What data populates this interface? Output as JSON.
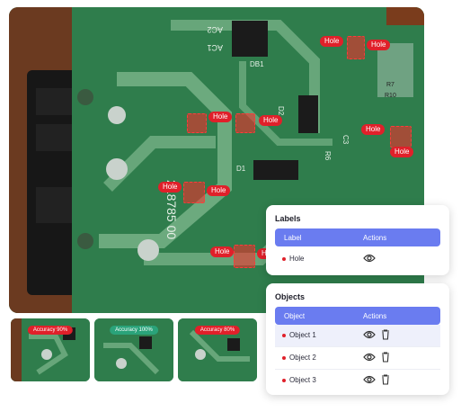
{
  "main_image": {
    "detections": [
      {
        "label": "Hole"
      },
      {
        "label": "Hole"
      },
      {
        "label": "Hole"
      },
      {
        "label": "Hole"
      },
      {
        "label": "Hole"
      },
      {
        "label": "Hole"
      },
      {
        "label": "Hole"
      },
      {
        "label": "Hole"
      },
      {
        "label": "Hole"
      },
      {
        "label": "Hole"
      }
    ],
    "board_text": {
      "ac2": "AC2",
      "ac1": "AC1",
      "db1": "DB1",
      "d1": "D1",
      "d2": "D2",
      "c3": "C3",
      "r6": "R6",
      "r7": "R7",
      "r10": "R10",
      "part_no": "218785 00"
    }
  },
  "thumbnails": [
    {
      "accuracy": "Accuracy 90%",
      "badge_color": "#e0202a"
    },
    {
      "accuracy": "Accuracy 100%",
      "badge_color": "#2aa37a"
    },
    {
      "accuracy": "Accuracy 80%",
      "badge_color": "#e0202a"
    }
  ],
  "labels_panel": {
    "title": "Labels",
    "col_label": "Label",
    "col_actions": "Actions",
    "rows": [
      {
        "name": "Hole",
        "color": "#e0202a"
      }
    ]
  },
  "objects_panel": {
    "title": "Objects",
    "col_object": "Object",
    "col_actions": "Actions",
    "rows": [
      {
        "name": "Object 1",
        "selected": true
      },
      {
        "name": "Object 2",
        "selected": false
      },
      {
        "name": "Object 3",
        "selected": false
      }
    ]
  },
  "colors": {
    "accent": "#6a7cf0",
    "hole": "#e0202a",
    "board": "#2f7a4c"
  },
  "icons": {
    "view": "eye-icon",
    "delete": "trash-icon"
  }
}
